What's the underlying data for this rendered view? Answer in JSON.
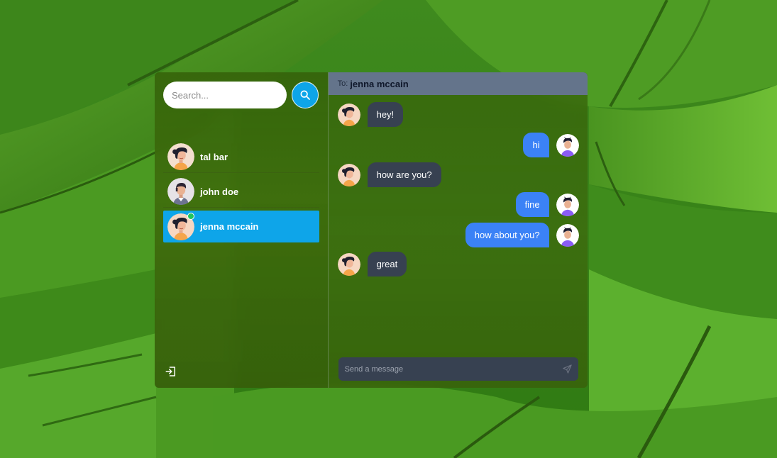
{
  "search": {
    "placeholder": "Search..."
  },
  "contacts": [
    {
      "name": "tal bar",
      "avatar": "woman-dark-hair-avatar",
      "active": false,
      "online": false
    },
    {
      "name": "john doe",
      "avatar": "man-avatar",
      "active": false,
      "online": false
    },
    {
      "name": "jenna mccain",
      "avatar": "woman-dark-hair-avatar",
      "active": true,
      "online": true
    }
  ],
  "chat": {
    "to_label": "To:",
    "recipient": "jenna mccain",
    "messages": [
      {
        "direction": "in",
        "text": "hey!"
      },
      {
        "direction": "out",
        "text": "hi"
      },
      {
        "direction": "in",
        "text": "how are you?"
      },
      {
        "direction": "out",
        "text": "fine"
      },
      {
        "direction": "out",
        "text": "how about you?"
      },
      {
        "direction": "in",
        "text": "great"
      }
    ],
    "composer_placeholder": "Send a message"
  },
  "icons": {
    "search": "search-icon",
    "logout": "logout-icon",
    "send": "send-icon"
  },
  "colors": {
    "accent": "#0ea5e9",
    "outgoing_bubble": "#3b82f6",
    "incoming_bubble": "#374151",
    "header": "#64748b",
    "online": "#22c55e"
  }
}
